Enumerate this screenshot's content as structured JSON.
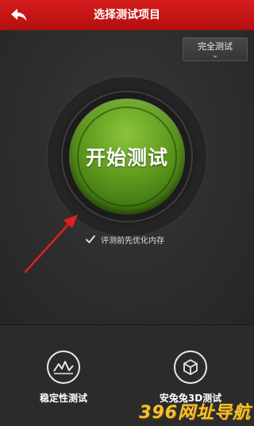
{
  "header": {
    "title": "选择测试项目",
    "back_icon": "back-arrow-icon",
    "bar_color": "#c41616"
  },
  "mode_selector": {
    "label": "完全测试"
  },
  "start_button": {
    "label": "开始测试",
    "color": "#5f9a1e"
  },
  "optimize_option": {
    "label": "评测前先优化内存",
    "checked": true
  },
  "features": [
    {
      "label": "稳定性测试",
      "icon": "stability-chart-icon"
    },
    {
      "label": "安兔兔3D测试",
      "icon": "cube-3d-icon"
    }
  ],
  "watermark": {
    "text": "396网址导航"
  }
}
